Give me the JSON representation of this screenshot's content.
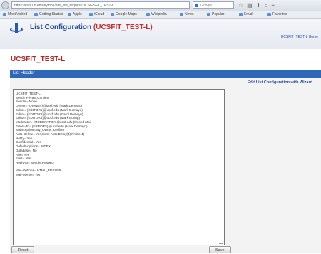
{
  "browser": {
    "url": "https://lists.uo.edu/sympa/edit_list_request/UCSF/SFT_TEST-L",
    "search_placeholder": "Google",
    "bookmarks": [
      "Most Visited",
      "Getting Started",
      "Apple",
      "iCloud",
      "Google Maps",
      "Wikipedia",
      "News",
      "Popular",
      "Email",
      "Favorites"
    ]
  },
  "header": {
    "title_prefix": "List Configuration",
    "title_list": "(UCSFIT_TEST-L)",
    "account_link": "UCSFIT_TEST-L Home"
  },
  "list_name": "UCSFIT_TEST-L",
  "section_label": "List Header",
  "edit_link": "Edit List Configuration with Wizard",
  "config_lines": [
    "UCSFIT_TEST-L",
    "Send= Private,Confirm",
    "Sender= None",
    "Owner= {OWNER}@ucsf.edu (Mark Demayo)",
    "Editor= {EDITOR1}@ucsf.edu (Mark Demayo)",
    "Editor= {EDITOR2}@ucsf.edu (Carol Demayo)",
    "Editor= {EDITOR3}@ucsf.edu (Mark Boring)",
    "Moderator= {MODERATOR}@ucsf.edu (Ilmond Mai)",
    "Errors-To= {ERRORS}@ucsf.edu (Mark Demayo)",
    "Subscription= By_Owner,Confirm",
    "Auto-Delete= Yes,Semi-Auto,Delay(4),Probe(4)",
    "Notify= Yes",
    "Confidential= Yes",
    "Default-options= INDEX",
    "Database= No",
    "Ack= Yes",
    "Files= Yes",
    "Reply-to= Sender,Respect",
    "",
    "Mail-Options= HTML_ERASER",
    "Mail-Merge= Yes"
  ],
  "buttons": {
    "reset": "Reset",
    "save": "Save"
  }
}
